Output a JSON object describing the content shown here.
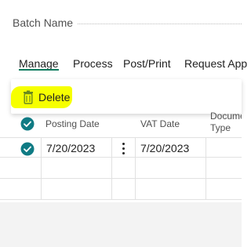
{
  "batch": {
    "label": "Batch Name"
  },
  "menu": {
    "items": [
      {
        "label": "Manage"
      },
      {
        "label": "Process"
      },
      {
        "label": "Post/Print"
      },
      {
        "label": "Request App"
      }
    ],
    "active": "Manage"
  },
  "dropdown": {
    "delete_label": "Delete",
    "delete_icon": "trash-icon"
  },
  "grid": {
    "columns": [
      "Posting Date",
      "VAT Date",
      "Document Type"
    ],
    "rows": [
      {
        "posting_date": "7/20/2023",
        "vat_date": "7/20/2023",
        "selected": true
      }
    ]
  },
  "colors": {
    "accent": "#0f7b5f",
    "highlight": "#f6ff00",
    "check": "#0f7b84"
  }
}
